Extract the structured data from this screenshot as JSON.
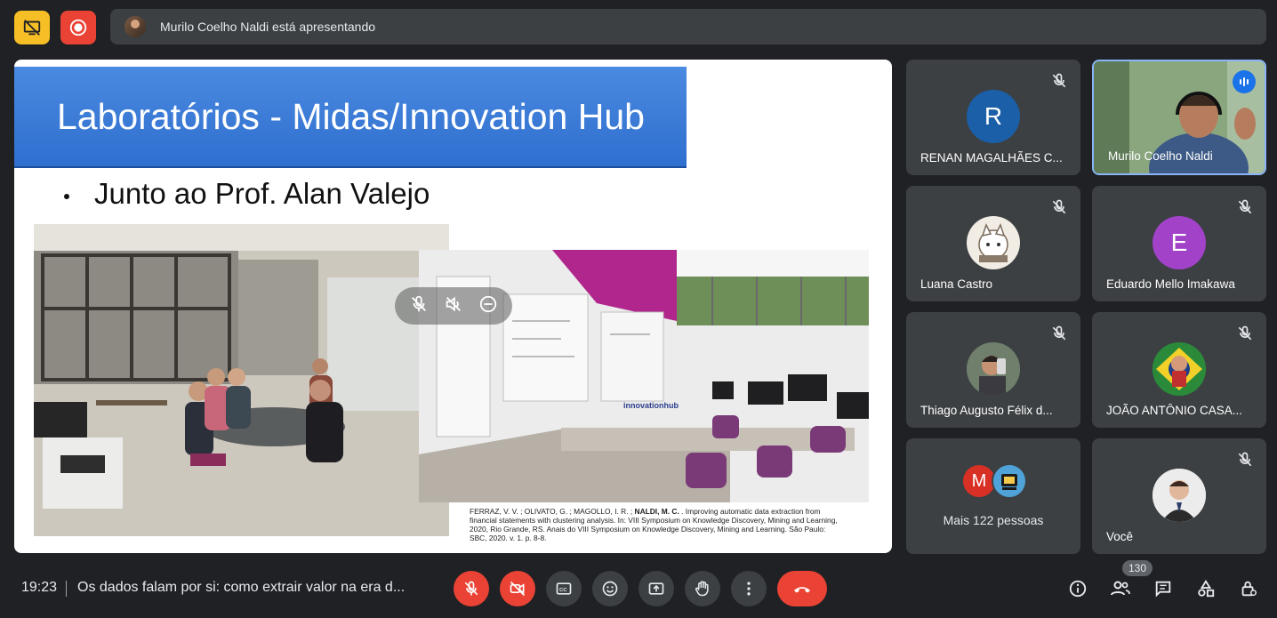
{
  "top": {
    "presenting_banner": "Murilo Coelho Naldi está apresentando"
  },
  "slide": {
    "title": "Laboratórios - Midas/Innovation Hub",
    "bullet": "Junto ao Prof. Alan Valejo",
    "citation": {
      "authors_prefix": "FERRAZ, V. V. ; OLIVATO, G. ; MAGOLLO, I. R. ; ",
      "authors_bold": "NALDI, M. C.",
      "text": " . Improving automatic data extraction from financial statements with clustering analysis. In: VIII Symposium on Knowledge Discovery, Mining and Learning, 2020, Rio Grande, RS. Anais do VIII Symposium on Knowledge Discovery, Mining and Learning. São Paulo: SBC, 2020. v. 1. p. 8-8."
    }
  },
  "participants": [
    {
      "name": "RENAN MAGALHÃES C...",
      "initial": "R",
      "color": "#1a5fa8"
    },
    {
      "name": "Murilo Coelho Naldi",
      "speaking": true
    },
    {
      "name": "Luana Castro"
    },
    {
      "name": "Eduardo Mello Imakawa",
      "initial": "E",
      "color": "#a142c9"
    },
    {
      "name": "Thiago Augusto Félix d..."
    },
    {
      "name": "JOÃO ANTÔNIO CASA..."
    },
    {
      "name": "Mais 122 pessoas",
      "initial": "M"
    },
    {
      "name": "Você"
    }
  ],
  "bottom": {
    "time": "19:23",
    "meeting_title": "Os dados falam por si: como extrair valor na era d...",
    "participant_count": "130"
  },
  "colors": {
    "background": "#202124",
    "tile": "#3c4043",
    "red": "#ea4335",
    "yellow": "#f6bf26",
    "accent_blue": "#8ab4f8"
  }
}
